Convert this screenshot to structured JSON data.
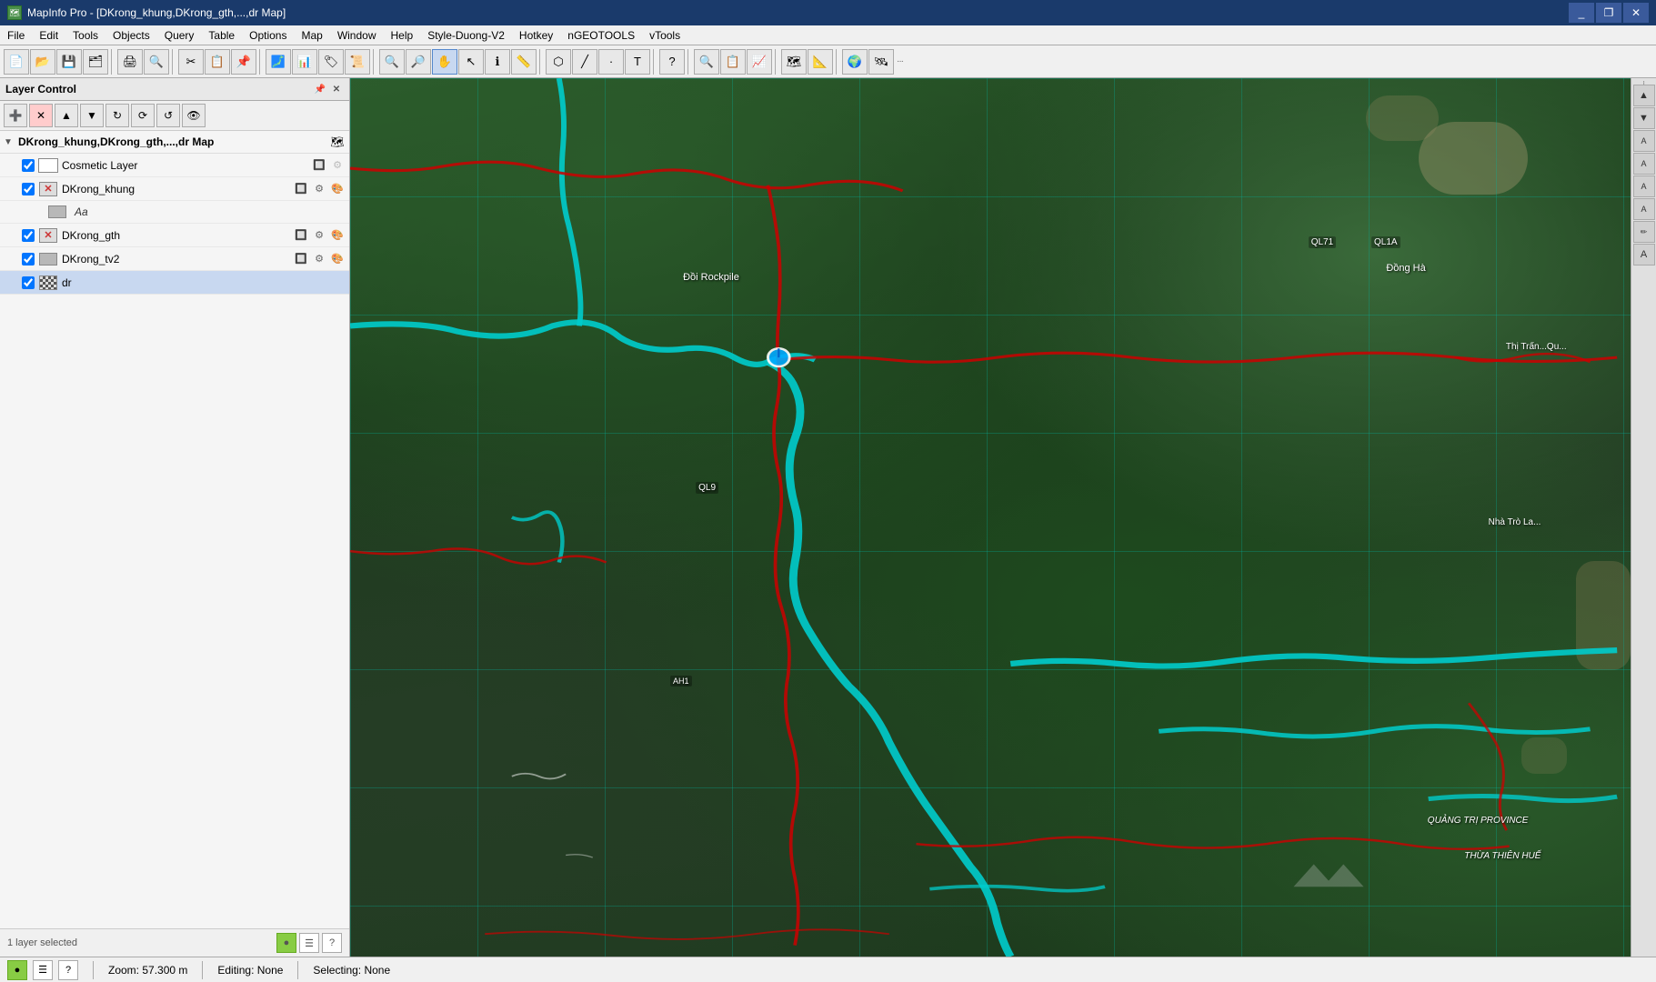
{
  "window": {
    "title": "MapInfo Pro - [DKrong_khung,DKrong_gth,...,dr Map]",
    "icon": "map"
  },
  "title_controls": {
    "minimize": "_",
    "restore": "❐",
    "close": "✕",
    "restore2": "❐",
    "close2": "✕"
  },
  "menu": {
    "items": [
      "File",
      "Edit",
      "Tools",
      "Objects",
      "Query",
      "Table",
      "Options",
      "Map",
      "Window",
      "Help",
      "Style-Duong-V2",
      "Hotkey",
      "nGEOTOOLS",
      "vTools"
    ]
  },
  "layer_panel": {
    "title": "Layer Control",
    "map_group": {
      "label": "DKrong_khung,DKrong_gth,...,dr Map",
      "arrow": "▼"
    },
    "layers": [
      {
        "id": "cosmetic",
        "name": "Cosmetic Layer",
        "checked": true,
        "icon_type": "cosmetic",
        "has_gear": false,
        "has_x_btn": false
      },
      {
        "id": "dkrong_khung",
        "name": "DKrong_khung",
        "checked": true,
        "icon_type": "x",
        "has_gear": true,
        "has_paint": true
      },
      {
        "id": "dkrong_khung_label",
        "name": "Aa",
        "checked": false,
        "icon_type": "aa",
        "is_sublabel": true
      },
      {
        "id": "dkrong_gth",
        "name": "DKrong_gth",
        "checked": true,
        "icon_type": "x",
        "has_gear": true,
        "has_paint": true
      },
      {
        "id": "dkrong_tv2",
        "name": "DKrong_tv2",
        "checked": true,
        "icon_type": "folder",
        "has_gear": true,
        "has_paint": true
      },
      {
        "id": "dr",
        "name": "dr",
        "checked": true,
        "icon_type": "checker",
        "has_gear": false,
        "has_paint": false,
        "selected": true
      }
    ],
    "status": {
      "selected_count": "1 layer selected"
    }
  },
  "layer_toolbar_buttons": [
    {
      "id": "add",
      "icon": "➕",
      "label": "Add Layer"
    },
    {
      "id": "remove",
      "icon": "✕",
      "label": "Remove Layer",
      "style": "red"
    },
    {
      "id": "up",
      "icon": "▲",
      "label": "Move Up"
    },
    {
      "id": "down",
      "icon": "▼",
      "label": "Move Down"
    },
    {
      "id": "refresh1",
      "icon": "↻",
      "label": "Refresh"
    },
    {
      "id": "refresh2",
      "icon": "⟳",
      "label": "Refresh All"
    },
    {
      "id": "refresh3",
      "icon": "↺",
      "label": "Reload"
    },
    {
      "id": "view",
      "icon": "👁",
      "label": "View"
    }
  ],
  "status_bar": {
    "zoom": "Zoom: 57.300 m",
    "editing": "Editing: None",
    "selecting": "Selecting: None"
  },
  "map": {
    "point_label": "Đồi Rockpile",
    "road_labels": [
      "QL1A",
      "QL71",
      "QL9",
      "Đồng Hà",
      "Thị Trấn...Qu...",
      "Nhà Trò La...",
      "QUẢNG TRỊ PROVINCE",
      "THỪA THIÊN HUẾ"
    ]
  }
}
